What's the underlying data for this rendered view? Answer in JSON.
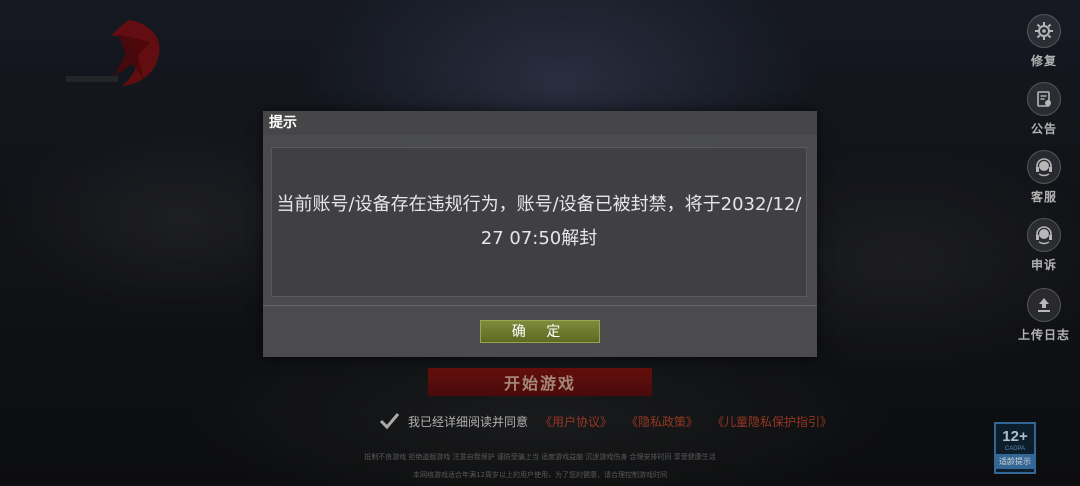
{
  "colors": {
    "start_button": "#6a1110",
    "confirm_button": "#6f7c2e",
    "link": "#b5432a",
    "age_badge": "#3f7fb7"
  },
  "side_menu": [
    {
      "label": "修复",
      "icon": "gear-repair-icon"
    },
    {
      "label": "公告",
      "icon": "announcement-icon"
    },
    {
      "label": "客服",
      "icon": "headset-icon"
    },
    {
      "label": "申诉",
      "icon": "headset-icon"
    },
    {
      "label": "上传日志",
      "icon": "upload-icon"
    }
  ],
  "main": {
    "start_button": "开始游戏",
    "agreement_text": "我已经详细阅读并同意",
    "links": [
      "《用户协议》",
      "《隐私政策》",
      "《儿童隐私保护指引》"
    ],
    "fine_print_1": "抵制不良游戏 拒绝盗版游戏 注意自我保护 谨防受骗上当 适度游戏益脑 沉迷游戏伤身 合理安排时间 享受健康生活",
    "fine_print_2": "本网络游戏适合年满12周岁以上的用户使用，为了您的健康，请合理控制游戏时间"
  },
  "age_badge": {
    "rating": "12+",
    "org": "CADPA",
    "tip": "适龄提示"
  },
  "dialog": {
    "title": "提示",
    "message": "当前账号/设备存在违规行为，账号/设备已被封禁，将于2032/12/27 07:50解封",
    "confirm": "确 定"
  }
}
